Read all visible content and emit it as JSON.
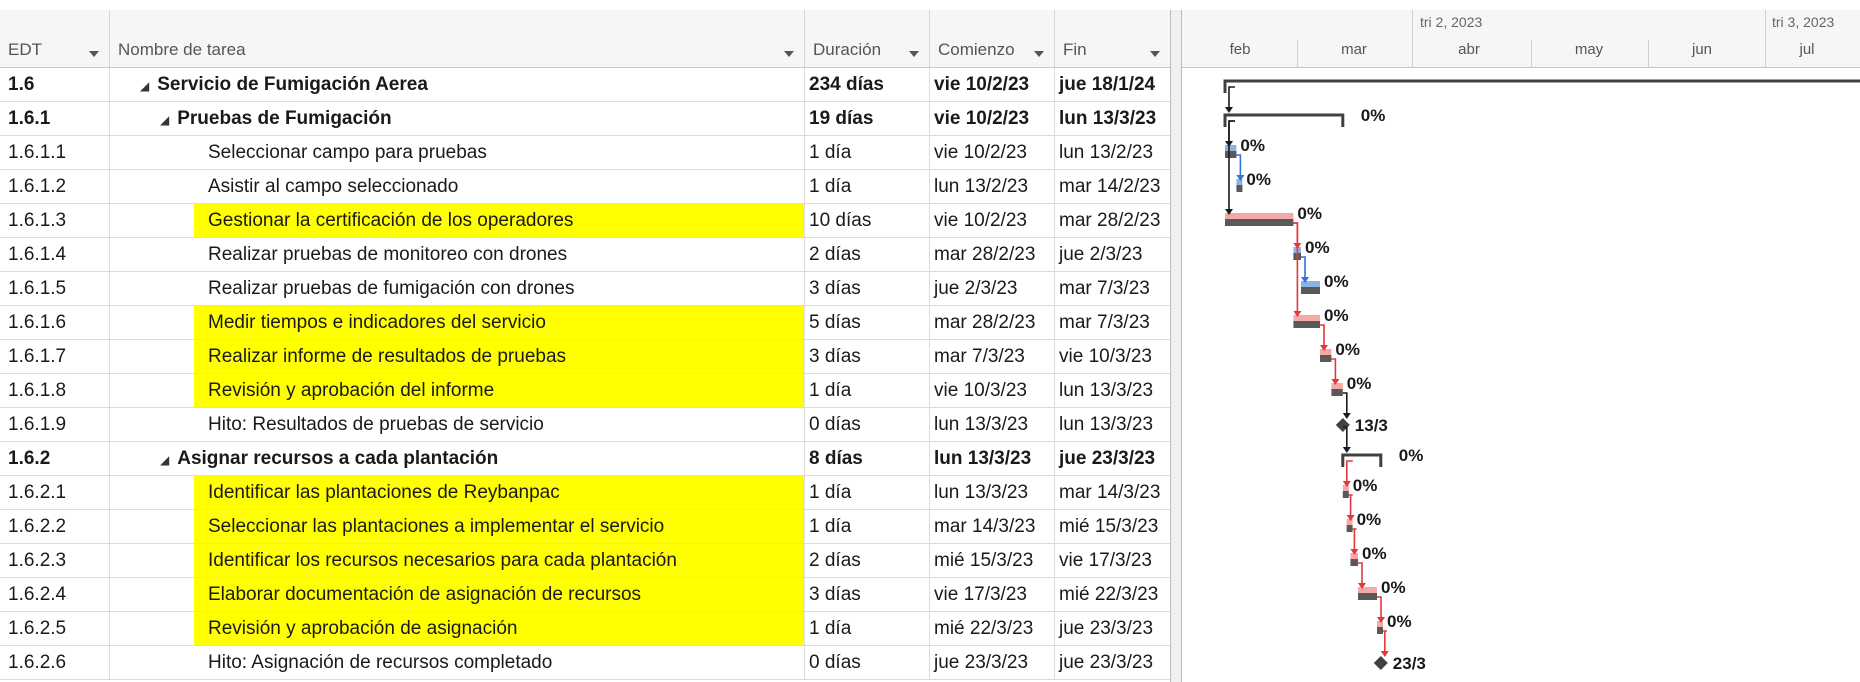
{
  "columns": {
    "edt": "EDT",
    "name": "Nombre de tarea",
    "duration": "Duración",
    "start": "Comienzo",
    "end": "Fin"
  },
  "timescale": {
    "quarters": [
      "tri 2, 2023",
      "tri 3, 2023"
    ],
    "months": [
      "feb",
      "mar",
      "abr",
      "may",
      "jun",
      "jul"
    ]
  },
  "colors": {
    "highlight": "#ffff00",
    "summary_bar": "#404040",
    "critical_bar": "#f4a9a9",
    "normal_bar": "#8db3e2",
    "critical_link": "#e0383e",
    "normal_link": "#2e75d6",
    "milestone": "#404040"
  },
  "tasks": [
    {
      "edt": "1.6",
      "name": "Servicio de Fumigación Aerea",
      "duration": "234 días",
      "start": "vie 10/2/23",
      "end": "jue 18/1/24",
      "level": 1,
      "summary": true,
      "highlight": false,
      "bar_label": ""
    },
    {
      "edt": "1.6.1",
      "name": "Pruebas de Fumigación",
      "duration": "19 días",
      "start": "vie 10/2/23",
      "end": "lun 13/3/23",
      "level": 2,
      "summary": true,
      "highlight": false,
      "bar_label": "0%"
    },
    {
      "edt": "1.6.1.1",
      "name": "Seleccionar campo para pruebas",
      "duration": "1 día",
      "start": "vie 10/2/23",
      "end": "lun 13/2/23",
      "level": 3,
      "summary": false,
      "highlight": false,
      "bar_label": "0%"
    },
    {
      "edt": "1.6.1.2",
      "name": "Asistir al campo seleccionado",
      "duration": "1 día",
      "start": "lun 13/2/23",
      "end": "mar 14/2/23",
      "level": 3,
      "summary": false,
      "highlight": false,
      "bar_label": "0%"
    },
    {
      "edt": "1.6.1.3",
      "name": "Gestionar la certificación de los operadores",
      "duration": "10 días",
      "start": "vie 10/2/23",
      "end": "mar 28/2/23",
      "level": 3,
      "summary": false,
      "highlight": true,
      "bar_label": "0%"
    },
    {
      "edt": "1.6.1.4",
      "name": "Realizar pruebas de monitoreo con drones",
      "duration": "2 días",
      "start": "mar 28/2/23",
      "end": "jue 2/3/23",
      "level": 3,
      "summary": false,
      "highlight": false,
      "bar_label": "0%"
    },
    {
      "edt": "1.6.1.5",
      "name": "Realizar pruebas de fumigación con drones",
      "duration": "3 días",
      "start": "jue 2/3/23",
      "end": "mar 7/3/23",
      "level": 3,
      "summary": false,
      "highlight": false,
      "bar_label": "0%"
    },
    {
      "edt": "1.6.1.6",
      "name": "Medir tiempos e indicadores del servicio",
      "duration": "5 días",
      "start": "mar 28/2/23",
      "end": "mar 7/3/23",
      "level": 3,
      "summary": false,
      "highlight": true,
      "bar_label": "0%"
    },
    {
      "edt": "1.6.1.7",
      "name": "Realizar informe de resultados de pruebas",
      "duration": "3 días",
      "start": "mar 7/3/23",
      "end": "vie 10/3/23",
      "level": 3,
      "summary": false,
      "highlight": true,
      "bar_label": "0%"
    },
    {
      "edt": "1.6.1.8",
      "name": "Revisión y aprobación del informe",
      "duration": "1 día",
      "start": "vie 10/3/23",
      "end": "lun 13/3/23",
      "level": 3,
      "summary": false,
      "highlight": true,
      "bar_label": "0%"
    },
    {
      "edt": "1.6.1.9",
      "name": "Hito: Resultados de pruebas de servicio",
      "duration": "0 días",
      "start": "lun 13/3/23",
      "end": "lun 13/3/23",
      "level": 3,
      "summary": false,
      "highlight": false,
      "bar_label": "13/3"
    },
    {
      "edt": "1.6.2",
      "name": "Asignar recursos a cada plantación",
      "duration": "8 días",
      "start": "lun 13/3/23",
      "end": "jue 23/3/23",
      "level": 2,
      "summary": true,
      "highlight": false,
      "bar_label": "0%"
    },
    {
      "edt": "1.6.2.1",
      "name": "Identificar las plantaciones de Reybanpac",
      "duration": "1 día",
      "start": "lun 13/3/23",
      "end": "mar 14/3/23",
      "level": 3,
      "summary": false,
      "highlight": true,
      "bar_label": "0%"
    },
    {
      "edt": "1.6.2.2",
      "name": "Seleccionar las plantaciones a implementar el servicio",
      "duration": "1 día",
      "start": "mar 14/3/23",
      "end": "mié 15/3/23",
      "level": 3,
      "summary": false,
      "highlight": true,
      "bar_label": "0%"
    },
    {
      "edt": "1.6.2.3",
      "name": "Identificar los recursos necesarios para cada plantación",
      "duration": "2 días",
      "start": "mié 15/3/23",
      "end": "vie 17/3/23",
      "level": 3,
      "summary": false,
      "highlight": true,
      "bar_label": "0%"
    },
    {
      "edt": "1.6.2.4",
      "name": "Elaborar documentación de asignación de recursos",
      "duration": "3 días",
      "start": "vie 17/3/23",
      "end": "mié 22/3/23",
      "level": 3,
      "summary": false,
      "highlight": true,
      "bar_label": "0%"
    },
    {
      "edt": "1.6.2.5",
      "name": "Revisión y aprobación de asignación",
      "duration": "1 día",
      "start": "mié 22/3/23",
      "end": "jue 23/3/23",
      "level": 3,
      "summary": false,
      "highlight": true,
      "bar_label": "0%"
    },
    {
      "edt": "1.6.2.6",
      "name": "Hito: Asignación de recursos completado",
      "duration": "0 días",
      "start": "jue 23/3/23",
      "end": "jue 23/3/23",
      "level": 3,
      "summary": false,
      "highlight": false,
      "bar_label": "23/3"
    }
  ]
}
